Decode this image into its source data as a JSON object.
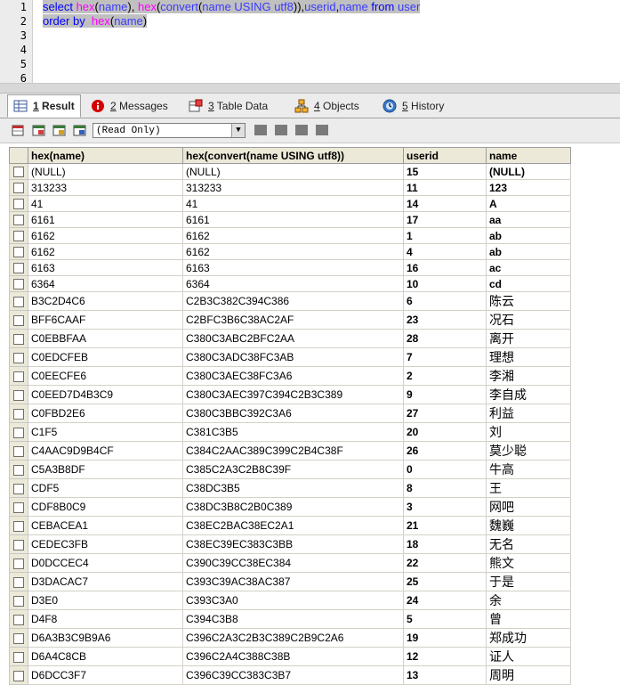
{
  "editor": {
    "line_numbers": [
      "1",
      "2",
      "3",
      "4",
      "5",
      "6"
    ],
    "line1": {
      "w1": "select ",
      "w2": "hex",
      "w3": "(",
      "w4": "name",
      "w5": "), ",
      "w6": "hex",
      "w7": "(",
      "w8": "convert",
      "w9": "(",
      "w10": "name USING utf8",
      "w11": ")),",
      "w12": "userid",
      "w13": ",",
      "w14": "name ",
      "w15": "from ",
      "w16": "user"
    },
    "line2": {
      "w1": "order by  ",
      "w2": "hex",
      "w3": "(",
      "w4": "name",
      "w5": ")"
    }
  },
  "tabs": [
    {
      "num": "1",
      "label": " Result"
    },
    {
      "num": "2",
      "label": " Messages"
    },
    {
      "num": "3",
      "label": " Table Data"
    },
    {
      "num": "4",
      "label": " Objects"
    },
    {
      "num": "5",
      "label": " History"
    }
  ],
  "toolbar": {
    "mode": "(Read Only)"
  },
  "grid": {
    "columns": [
      "hex(name)",
      "hex(convert(name USING utf8))",
      "userid",
      "name"
    ],
    "rows": [
      [
        "(NULL)",
        "(NULL)",
        "15",
        "(NULL)"
      ],
      [
        "313233",
        "313233",
        "11",
        "123"
      ],
      [
        "41",
        "41",
        "14",
        "A"
      ],
      [
        "6161",
        "6161",
        "17",
        "aa"
      ],
      [
        "6162",
        "6162",
        "1",
        "ab"
      ],
      [
        "6162",
        "6162",
        "4",
        "ab"
      ],
      [
        "6163",
        "6163",
        "16",
        "ac"
      ],
      [
        "6364",
        "6364",
        "10",
        "cd"
      ],
      [
        "B3C2D4C6",
        "C2B3C382C394C386",
        "6",
        "陈云"
      ],
      [
        "BFF6CAAF",
        "C2BFC3B6C38AC2AF",
        "23",
        "况石"
      ],
      [
        "C0EBBFAA",
        "C380C3ABC2BFC2AA",
        "28",
        "离开"
      ],
      [
        "C0EDCFEB",
        "C380C3ADC38FC3AB",
        "7",
        "理想"
      ],
      [
        "C0EECFE6",
        "C380C3AEC38FC3A6",
        "2",
        "李湘"
      ],
      [
        "C0EED7D4B3C9",
        "C380C3AEC397C394C2B3C389",
        "9",
        "李自成"
      ],
      [
        "C0FBD2E6",
        "C380C3BBC392C3A6",
        "27",
        "利益"
      ],
      [
        "C1F5",
        "C381C3B5",
        "20",
        "刘"
      ],
      [
        "C4AAC9D9B4CF",
        "C384C2AAC389C399C2B4C38F",
        "26",
        "莫少聪"
      ],
      [
        "C5A3B8DF",
        "C385C2A3C2B8C39F",
        "0",
        "牛高"
      ],
      [
        "CDF5",
        "C38DC3B5",
        "8",
        "王"
      ],
      [
        "CDF8B0C9",
        "C38DC3B8C2B0C389",
        "3",
        "网吧"
      ],
      [
        "CEBACEA1",
        "C38EC2BAC38EC2A1",
        "21",
        "魏巍"
      ],
      [
        "CEDEC3FB",
        "C38EC39EC383C3BB",
        "18",
        "无名"
      ],
      [
        "D0DCCEC4",
        "C390C39CC38EC384",
        "22",
        "熊文"
      ],
      [
        "D3DACAC7",
        "C393C39AC38AC387",
        "25",
        "于是"
      ],
      [
        "D3E0",
        "C393C3A0",
        "24",
        "余"
      ],
      [
        "D4F8",
        "C394C3B8",
        "5",
        "曾"
      ],
      [
        "D6A3B3C9B9A6",
        "C396C2A3C2B3C389C2B9C2A6",
        "19",
        "郑成功"
      ],
      [
        "D6A4C8CB",
        "C396C2A4C388C38B",
        "12",
        "证人"
      ],
      [
        "D6DCC3F7",
        "C396C39CC383C3B7",
        "13",
        "周明"
      ]
    ]
  }
}
